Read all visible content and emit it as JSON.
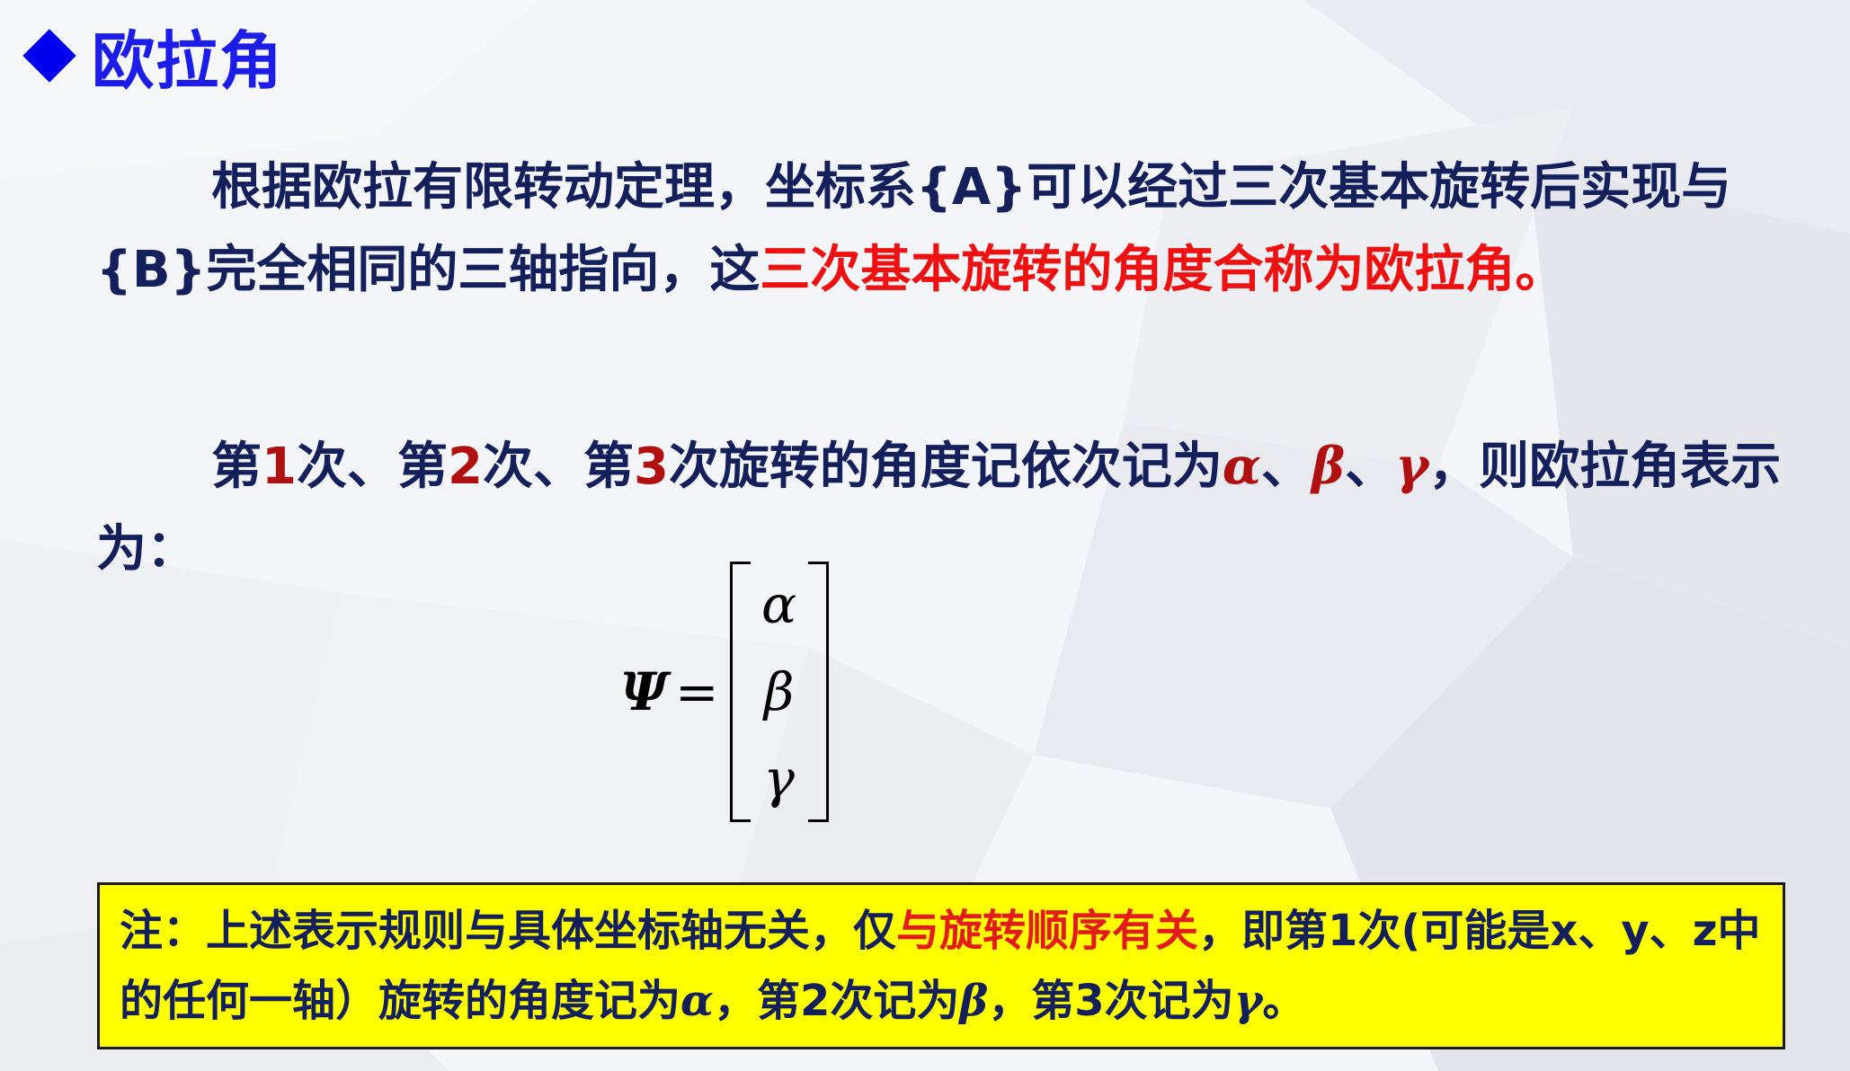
{
  "heading": "欧拉角",
  "para1": {
    "part1": "根据欧拉有限转动定理，坐标系{A}可以经过三次基本旋转后实现与{B}完全相同的三轴指向，这",
    "highlight": "三次基本旋转的角度合称为欧拉角。"
  },
  "para2": {
    "t1": "第",
    "n1": "1",
    "t2": "次、第",
    "n2": "2",
    "t3": "次、第",
    "n3": "3",
    "t4": "次旋转的角度记依次记为",
    "alpha": "α",
    "sep1": "、",
    "beta": "β",
    "sep2": "、",
    "gamma": "γ",
    "t5": "，则欧拉角表示为："
  },
  "formula": {
    "lhs": "Ψ",
    "eq": "=",
    "entries": [
      "α",
      "β",
      "γ"
    ]
  },
  "note": {
    "t1": "注：上述表示规则与具体坐标轴无关，仅",
    "highlight": "与旋转顺序有关",
    "t2": "，即第1次(可能是x、y、z中的任何一轴）旋转的角度记为",
    "alpha": "α",
    "t3": "，第2次记为",
    "beta": "β",
    "t4": "，第3次记为",
    "gamma": "γ",
    "t5": "。"
  }
}
